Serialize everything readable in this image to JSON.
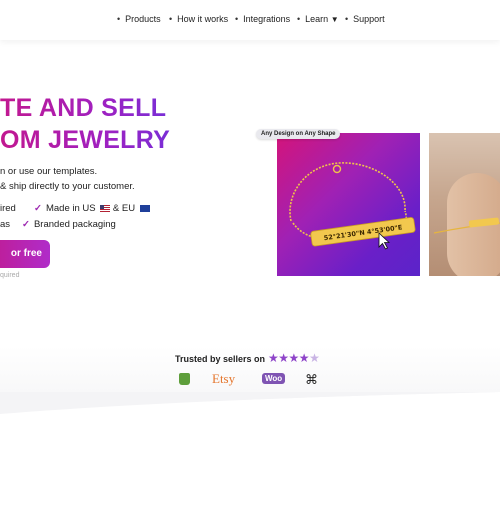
{
  "nav": {
    "items": [
      {
        "label": "Products"
      },
      {
        "label": "How it works"
      },
      {
        "label": "Integrations"
      },
      {
        "label": "Learn",
        "caret": "▼"
      },
      {
        "label": "Support"
      }
    ]
  },
  "hero": {
    "title_line1": "TE AND SELL",
    "title_line2": "OM JEWELRY",
    "sub_line1": "n or use our templates.",
    "sub_line2": "& ship directly to your customer.",
    "checks": [
      {
        "text": "ired"
      },
      {
        "text": "Made in US",
        "flag1": "us",
        "mid": "& EU",
        "flag2": "eu"
      },
      {
        "text": "as"
      },
      {
        "text": "Branded packaging"
      }
    ],
    "check_mark": "✓",
    "cta_label": "or free",
    "fine_print": "quired",
    "accent_gradient": [
      "#c2188f",
      "#7a2dd6"
    ]
  },
  "showcase": {
    "badge": "Any Design on Any Shape",
    "engraving": "52°21'30\"N 4°53'00\"E",
    "card1_colors": [
      "#d4147a",
      "#5b24c9"
    ],
    "card2_engraving": "∙∙∙∙∙∙"
  },
  "trust": {
    "label": "Trusted by sellers on",
    "rating": 4,
    "max_rating": 5,
    "star_glyph": "★",
    "logos": [
      {
        "name": "Shopify",
        "icon": "shopify-bag-icon"
      },
      {
        "name": "Etsy"
      },
      {
        "name": "Woo"
      },
      {
        "name": "Squarespace",
        "icon": "squarespace-icon"
      }
    ]
  }
}
